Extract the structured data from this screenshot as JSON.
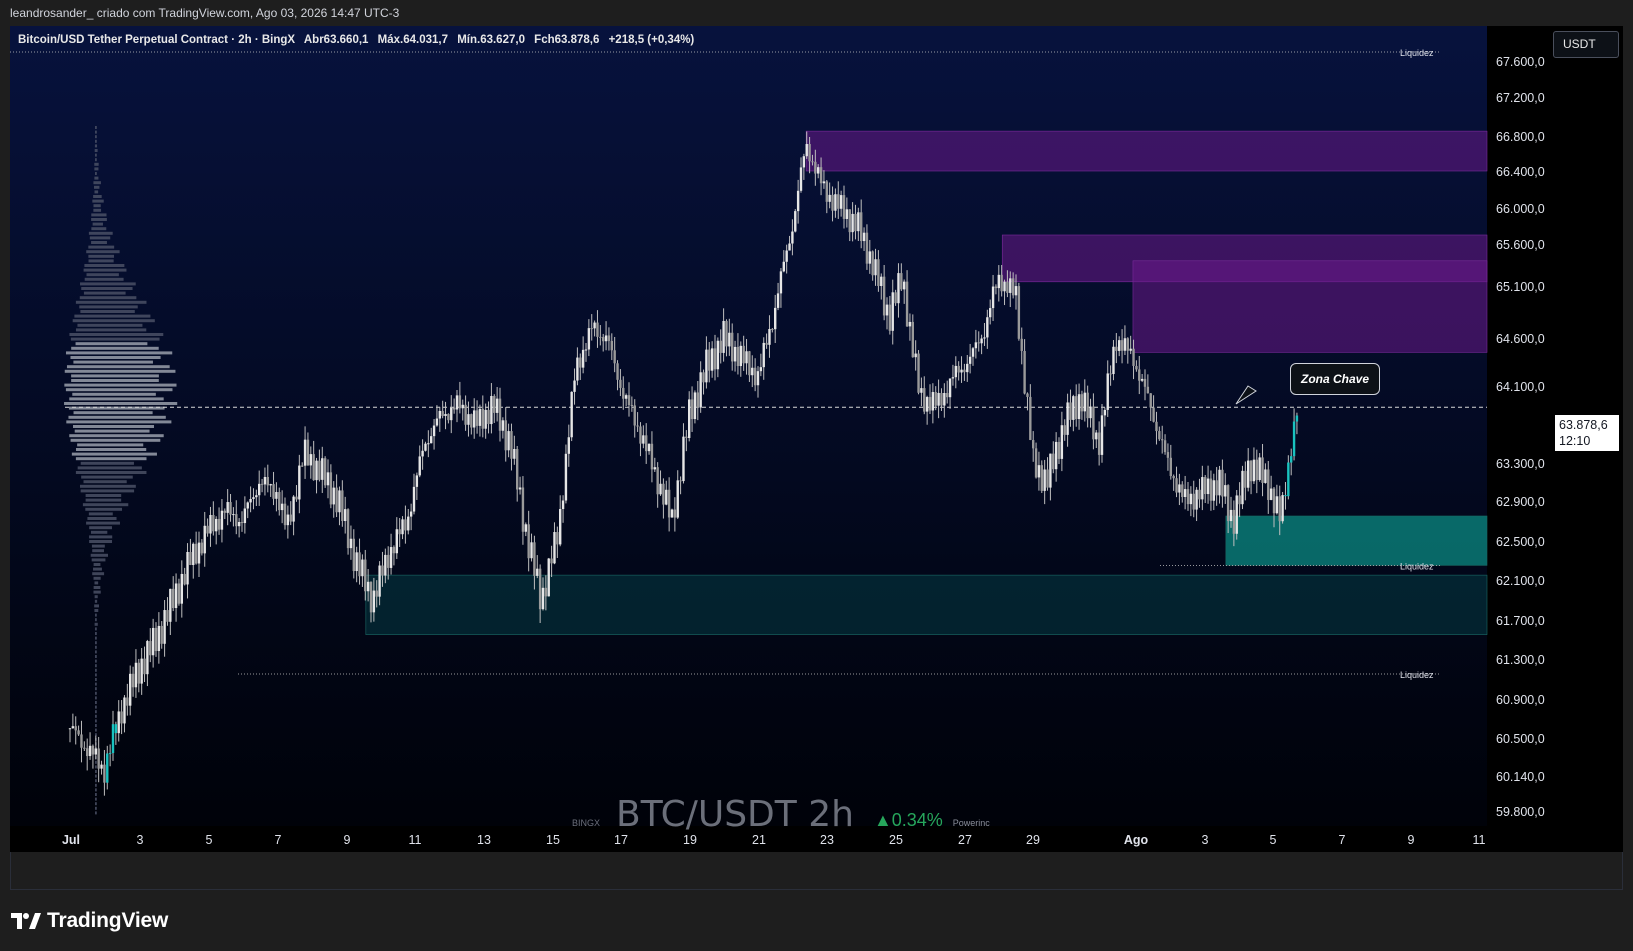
{
  "header": {
    "attribution": "leandrosander_ criado com TradingView.com, Ago 03, 2026 14:47 UTC-3"
  },
  "symbol_bar": {
    "title": "Bitcoin/USD Tether Perpetual Contract · 2h · BingX",
    "open": "Abr63.660,1",
    "high": "Máx.64.031,7",
    "low": "Mín.63.627,0",
    "close": "Fch63.878,6",
    "change": "+218,5 (+0,34%)"
  },
  "currency_button": "USDT",
  "current_price": {
    "value": "63.878,6",
    "countdown": "12:10"
  },
  "callout": "Zona Chave",
  "watermark": {
    "exchange": "BINGX",
    "symbol": "BTC/USDT 2h",
    "change": "▲0.34%",
    "by": "Powerinc"
  },
  "logo": {
    "text": "TradingView"
  },
  "colors": {
    "background": "#030a28",
    "supply_zone": "#6a1a8a",
    "demand_zone": "#0b8a82",
    "candle": "#e6e6e6",
    "grid_text": "#e0e3eb"
  },
  "chart_data": {
    "type": "candlestick",
    "timeframe": "2h",
    "y_ticks": [
      "67.600,0",
      "67.200,0",
      "66.800,0",
      "66.400,0",
      "66.000,0",
      "65.600,0",
      "65.100,0",
      "64.600,0",
      "64.100,0",
      "63.300,0",
      "62.900,0",
      "62.500,0",
      "62.100,0",
      "61.700,0",
      "61.300,0",
      "60.900,0",
      "60.500,0",
      "60.140,0",
      "59.800,0"
    ],
    "x_ticks": [
      "Jul",
      "3",
      "5",
      "7",
      "9",
      "11",
      "13",
      "15",
      "17",
      "19",
      "21",
      "23",
      "25",
      "27",
      "29",
      "Ago",
      "3",
      "5",
      "7",
      "9",
      "11"
    ],
    "liquidity_labels": [
      {
        "label": "Liquidez",
        "price": 67700
      },
      {
        "label": "Liquidez",
        "price": 62250
      },
      {
        "label": "Liquidez",
        "price": 61150
      }
    ],
    "zones": [
      {
        "kind": "supply",
        "from_day": 21.4,
        "price_top": 66.85,
        "price_bottom": 66.4
      },
      {
        "kind": "supply",
        "from_day": 27.1,
        "price_top": 65.7,
        "price_bottom": 65.15
      },
      {
        "kind": "supply",
        "from_day": 30.9,
        "price_top": 65.4,
        "price_bottom": 64.45
      },
      {
        "kind": "demand",
        "from_day": 33.6,
        "price_top": 62.75,
        "price_bottom": 62.25
      },
      {
        "kind": "demand",
        "from_day": 8.6,
        "price_top": 62.15,
        "price_bottom": 61.55
      }
    ],
    "current_price_level": 63878.6,
    "price_path": [
      [
        0,
        60600
      ],
      [
        0.5,
        60400
      ],
      [
        1,
        60200
      ],
      [
        1.5,
        60800
      ],
      [
        2,
        61200
      ],
      [
        2.5,
        61500
      ],
      [
        3,
        61900
      ],
      [
        3.5,
        62300
      ],
      [
        4,
        62600
      ],
      [
        4.5,
        62800
      ],
      [
        5,
        62700
      ],
      [
        5.5,
        63100
      ],
      [
        6,
        63000
      ],
      [
        6.3,
        62600
      ],
      [
        6.8,
        63400
      ],
      [
        7.3,
        63200
      ],
      [
        7.8,
        62900
      ],
      [
        8.3,
        62300
      ],
      [
        8.8,
        61900
      ],
      [
        9.3,
        62400
      ],
      [
        9.8,
        62700
      ],
      [
        10.3,
        63500
      ],
      [
        10.8,
        63800
      ],
      [
        11.3,
        63900
      ],
      [
        11.8,
        63700
      ],
      [
        12.3,
        63900
      ],
      [
        12.8,
        63500
      ],
      [
        13.3,
        62500
      ],
      [
        13.7,
        61900
      ],
      [
        14.2,
        62600
      ],
      [
        14.7,
        64300
      ],
      [
        15.2,
        64700
      ],
      [
        15.6,
        64600
      ],
      [
        16.1,
        64000
      ],
      [
        16.6,
        63600
      ],
      [
        17.1,
        63100
      ],
      [
        17.5,
        62700
      ],
      [
        18,
        63800
      ],
      [
        18.5,
        64300
      ],
      [
        19,
        64600
      ],
      [
        19.5,
        64400
      ],
      [
        20,
        64200
      ],
      [
        20.5,
        64900
      ],
      [
        21,
        65800
      ],
      [
        21.4,
        66700
      ],
      [
        21.9,
        66200
      ],
      [
        22.4,
        66000
      ],
      [
        22.9,
        65800
      ],
      [
        23.3,
        65400
      ],
      [
        23.8,
        64800
      ],
      [
        24.2,
        65200
      ],
      [
        24.7,
        64000
      ],
      [
        25.2,
        63900
      ],
      [
        25.7,
        64200
      ],
      [
        26.2,
        64400
      ],
      [
        26.6,
        64700
      ],
      [
        27,
        65200
      ],
      [
        27.5,
        65000
      ],
      [
        28,
        63300
      ],
      [
        28.4,
        63100
      ],
      [
        28.9,
        63700
      ],
      [
        29.4,
        64000
      ],
      [
        29.9,
        63500
      ],
      [
        30.4,
        64600
      ],
      [
        30.9,
        64400
      ],
      [
        31.4,
        63900
      ],
      [
        31.9,
        63300
      ],
      [
        32.4,
        62900
      ],
      [
        32.9,
        63000
      ],
      [
        33.4,
        63100
      ],
      [
        33.8,
        62700
      ],
      [
        34.3,
        63300
      ],
      [
        34.8,
        63100
      ],
      [
        35.2,
        62700
      ],
      [
        35.5,
        63500
      ],
      [
        35.7,
        63879
      ]
    ]
  }
}
